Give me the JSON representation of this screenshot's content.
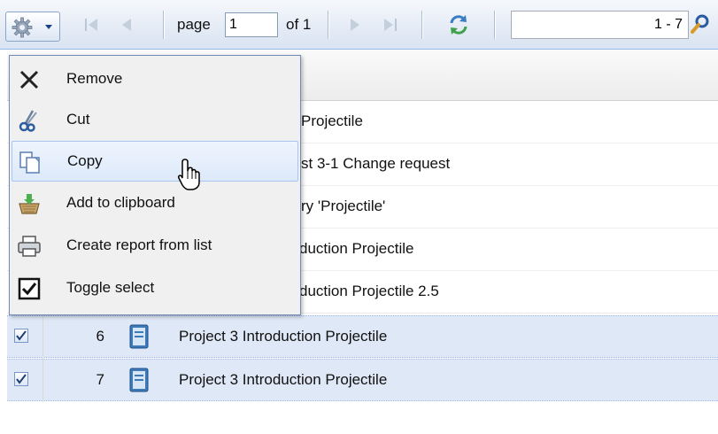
{
  "toolbar": {
    "page_label": "page",
    "page_value": "1",
    "of_label": "of 1",
    "search_value": "1 - 7"
  },
  "menu": {
    "items": [
      {
        "label": "Remove",
        "icon": "close-icon"
      },
      {
        "label": "Cut",
        "icon": "scissors-icon"
      },
      {
        "label": "Copy",
        "icon": "copy-icon"
      },
      {
        "label": "Add to clipboard",
        "icon": "clipboard-basket-icon"
      },
      {
        "label": "Create report from list",
        "icon": "printer-icon"
      },
      {
        "label": "Toggle select",
        "icon": "checkbox-icon"
      }
    ],
    "hovered_item": "Copy"
  },
  "grid": {
    "partial_rows": [
      "Projectile",
      "st 3-1 Change request",
      "ry 'Projectile'",
      "duction Projectile",
      "duction Projectile 2.5"
    ],
    "rows": [
      {
        "num": "6",
        "title": "Project 3 Introduction Projectile",
        "checked": true
      },
      {
        "num": "7",
        "title": "Project 3 Introduction Projectile",
        "checked": true
      }
    ]
  },
  "colors": {
    "accent": "#15428b",
    "selected_row": "#dfe8f6",
    "menu_hover": "#dde9fa",
    "doc_icon": "#3d7ab8"
  }
}
